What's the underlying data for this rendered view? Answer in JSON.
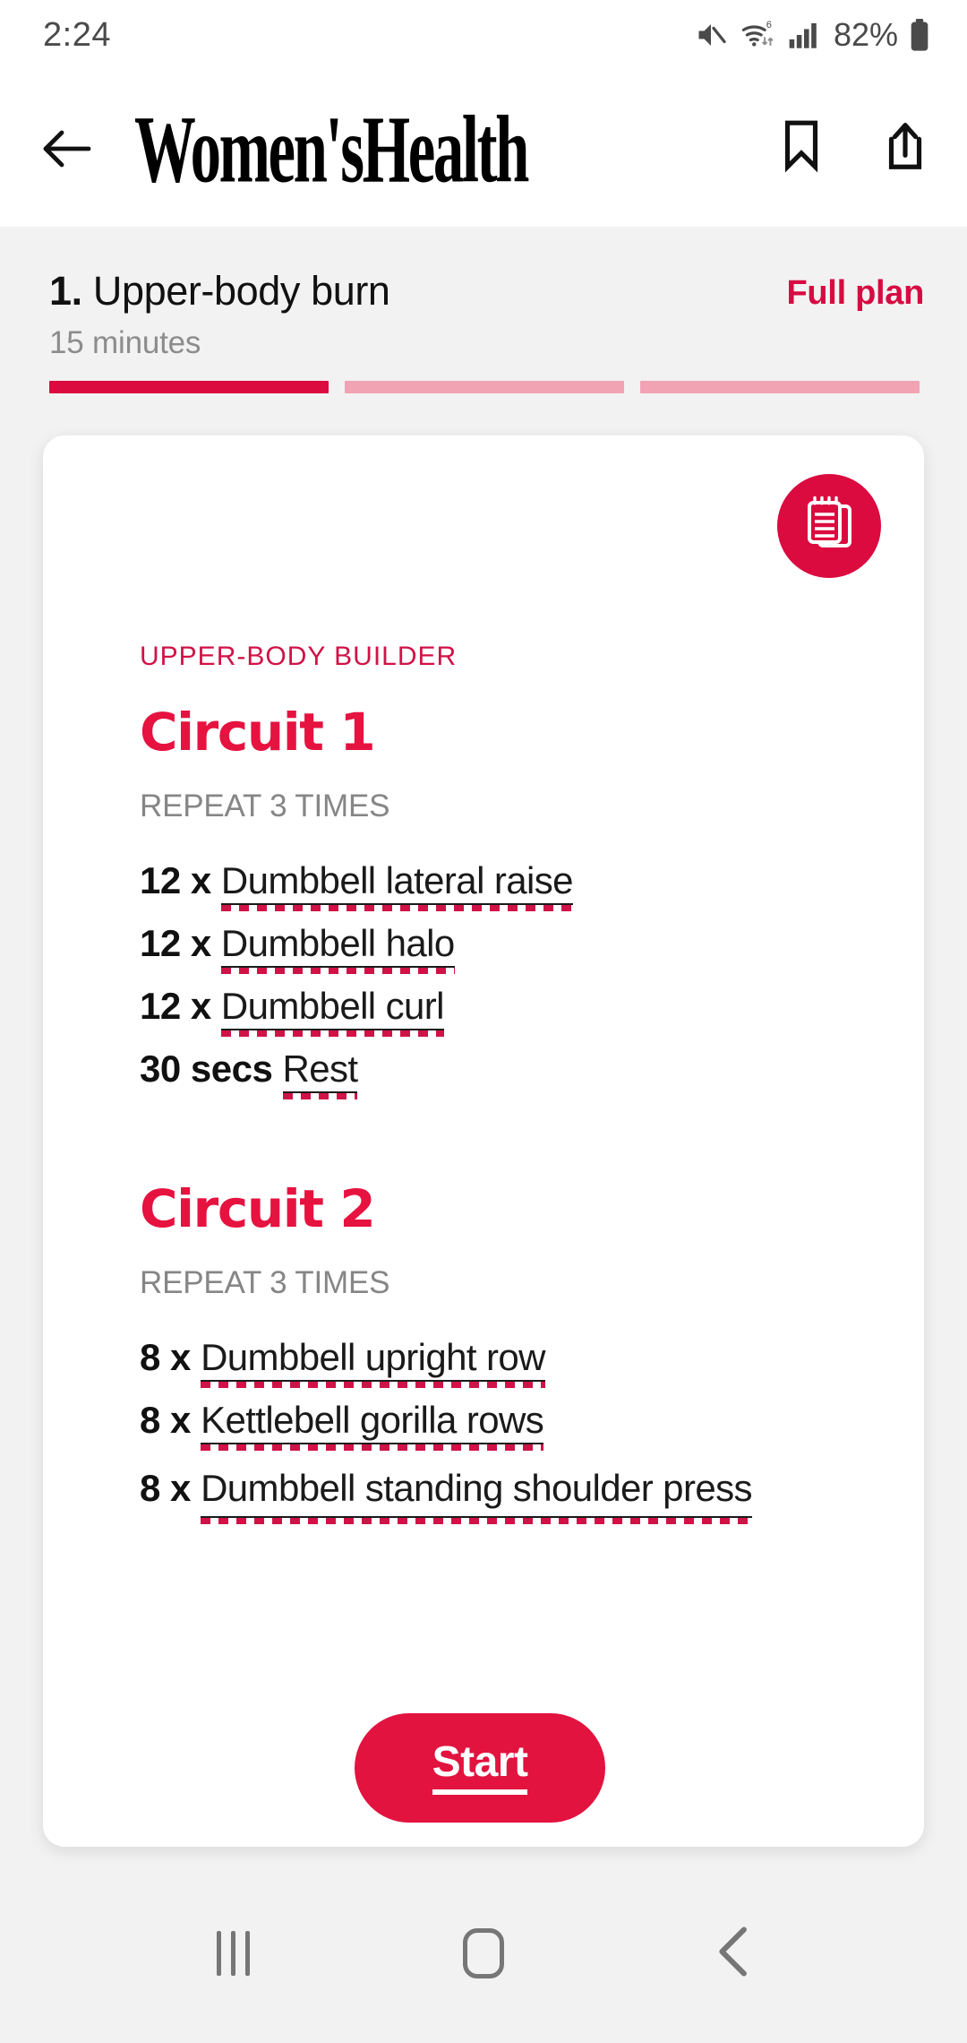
{
  "status_bar": {
    "time": "2:24",
    "battery_percent": "82%",
    "icons": [
      "mute-icon",
      "wifi-6-icon",
      "signal-bars-icon",
      "battery-icon"
    ]
  },
  "app_header": {
    "back_icon": "back-arrow-icon",
    "brand": "Women'sHealth",
    "bookmark_icon": "bookmark-icon",
    "share_icon": "share-icon"
  },
  "subheader": {
    "index": "1.",
    "title": "Upper-body burn",
    "duration": "15 minutes",
    "full_plan_label": "Full plan",
    "progress": {
      "total": 3,
      "active": 1
    }
  },
  "card": {
    "notes_icon": "notepad-icon",
    "kicker": "UPPER-BODY BUILDER",
    "circuits": [
      {
        "title": "Circuit 1",
        "repeat": "REPEAT 3 TIMES",
        "exercises": [
          {
            "reps": "12 x",
            "name": "Dumbbell lateral raise"
          },
          {
            "reps": "12 x",
            "name": "Dumbbell halo"
          },
          {
            "reps": "12 x",
            "name": "Dumbbell curl"
          },
          {
            "reps": "30 secs",
            "name": "Rest"
          }
        ]
      },
      {
        "title": "Circuit 2",
        "repeat": "REPEAT 3 TIMES",
        "exercises": [
          {
            "reps": "8 x",
            "name": "Dumbbell upright row"
          },
          {
            "reps": "8 x",
            "name": "Kettlebell gorilla rows"
          },
          {
            "reps": "8 x",
            "name": "Dumbbell standing shoulder press"
          }
        ]
      }
    ]
  },
  "start_button": {
    "label": "Start"
  },
  "nav_bar": {
    "recents_label": "recents-icon",
    "home_label": "home-icon",
    "back_label": "back-icon"
  },
  "colors": {
    "brand_crimson": "#db0a3f",
    "accent_red": "#e6123f",
    "link_dash": "#d01247",
    "muted_gray": "#868686",
    "page_bg": "#f2f2f2"
  }
}
